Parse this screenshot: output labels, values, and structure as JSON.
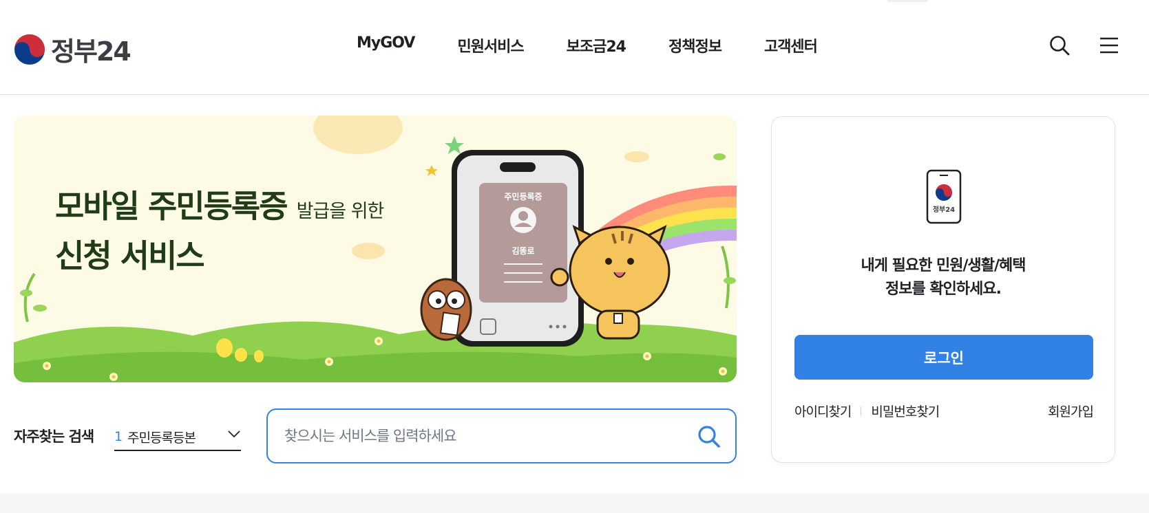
{
  "header": {
    "logo_text": "정부24",
    "nav": [
      {
        "label": "MyGOV"
      },
      {
        "label": "민원서비스"
      },
      {
        "label": "보조금24"
      },
      {
        "label": "정책정보"
      },
      {
        "label": "고객센터"
      }
    ],
    "icons": {
      "search": "search-icon",
      "menu": "hamburger-menu-icon"
    }
  },
  "banner": {
    "title_line1": "모바일 주민등록증",
    "title_line1_small": "발급을 위한",
    "title_line2": "신청 서비스",
    "card_title": "주민등록증",
    "card_name": "김똥로"
  },
  "login": {
    "device_label": "정부24",
    "message_line1": "내게 필요한 민원/생활/혜택",
    "message_line2": "정보를 확인하세요.",
    "login_button": "로그인",
    "find_id": "아이디찾기",
    "find_password": "비밀번호찾기",
    "signup": "회원가입"
  },
  "search": {
    "frequent_label": "자주찾는 검색",
    "frequent_selected_number": "1",
    "frequent_selected_text": "주민등록등본",
    "placeholder": "찾으시는 서비스를 입력하세요"
  },
  "colors": {
    "accent": "#3282e6",
    "banner_bg": "#fdfbe6",
    "grass": "#7cc442",
    "title_green": "#1f3b18"
  }
}
